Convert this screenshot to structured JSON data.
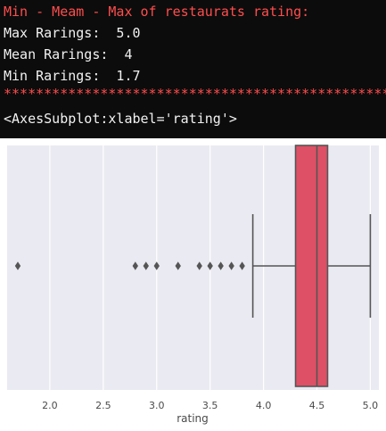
{
  "console": {
    "heading": "Min - Meam - Max of restaurats rating:",
    "max_line": "Max Rarings:  5.0",
    "mean_line": "Mean Rarings:  4",
    "min_line": "Min Rarings:  1.7",
    "separator": "****************************************************",
    "repr": "<AxesSubplot:xlabel='rating'>"
  },
  "colors": {
    "heading": "#ff4d4d",
    "console_bg": "#0c0c0c",
    "plot_bg": "#eaeaf2",
    "box_fill": "#dd5065",
    "whisker": "#555555"
  },
  "chart_data": {
    "type": "box",
    "xlabel": "rating",
    "xlim": [
      1.6,
      5.08
    ],
    "xticks": [
      "2.0",
      "2.5",
      "3.0",
      "3.5",
      "4.0",
      "4.5",
      "5.0"
    ],
    "xtick_values": [
      2.0,
      2.5,
      3.0,
      3.5,
      4.0,
      4.5,
      5.0
    ],
    "grid": true,
    "box": {
      "q1": 4.3,
      "median": 4.5,
      "q3": 4.6,
      "whisker_low": 3.9,
      "whisker_high": 5.0
    },
    "outliers": [
      1.7,
      2.8,
      2.9,
      3.0,
      3.2,
      3.4,
      3.5,
      3.6,
      3.7,
      3.8
    ]
  }
}
